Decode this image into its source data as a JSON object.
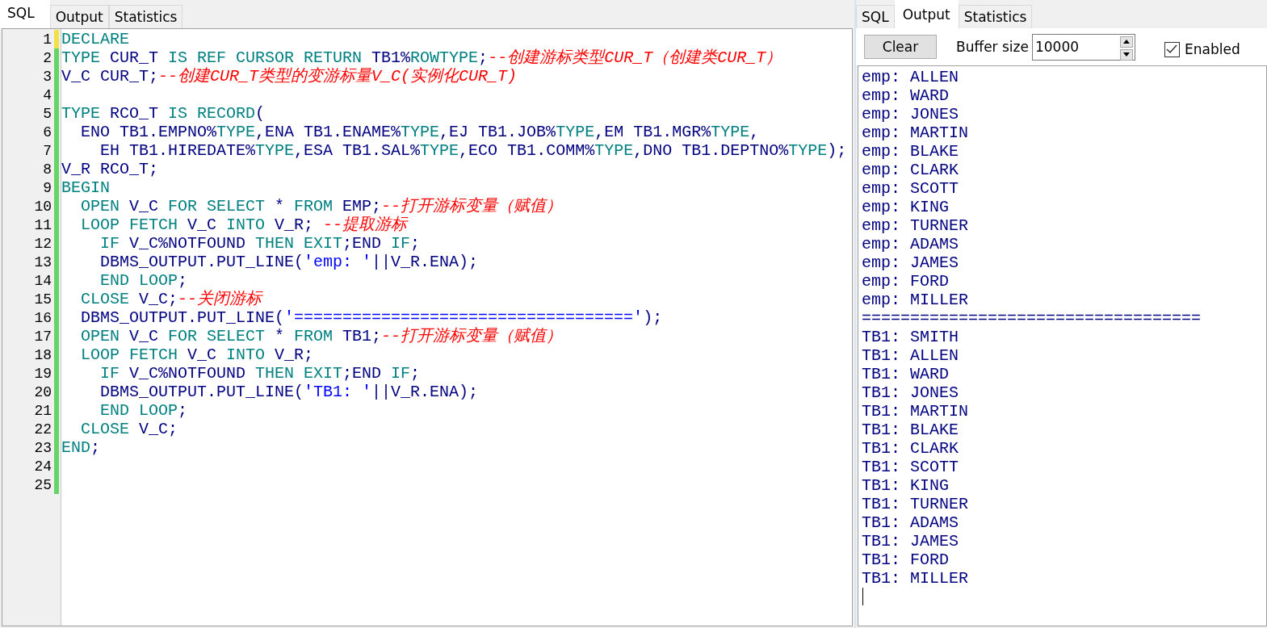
{
  "left_pane": {
    "tabs": [
      {
        "label": "SQL",
        "selected": true
      },
      {
        "label": "Output",
        "selected": false
      },
      {
        "label": "Statistics",
        "selected": false
      }
    ],
    "editor": {
      "lines": [
        {
          "number": "1",
          "color": "#f2e04a",
          "tokens": [
            {
              "kind": "keyword",
              "text": "DECLARE"
            }
          ]
        },
        {
          "number": "2",
          "color": "#66d466",
          "tokens": [
            {
              "kind": "keyword",
              "text": "TYPE "
            },
            {
              "kind": "ident",
              "text": "CUR_T "
            },
            {
              "kind": "keyword",
              "text": "IS REF CURSOR RETURN "
            },
            {
              "kind": "ident",
              "text": "TB1%"
            },
            {
              "kind": "keyword",
              "text": "ROWTYPE"
            },
            {
              "kind": "ident",
              "text": ";"
            },
            {
              "kind": "comment",
              "text": "--创建游标类型CUR_T（创建类CUR_T）"
            }
          ]
        },
        {
          "number": "3",
          "color": "#66d466",
          "tokens": [
            {
              "kind": "ident",
              "text": "V_C CUR_T;"
            },
            {
              "kind": "comment",
              "text": "--创建CUR_T类型的变游标量V_C(实例化CUR_T)"
            }
          ]
        },
        {
          "number": "4",
          "color": "#66d466"
        },
        {
          "number": "5",
          "color": "#66d466",
          "tokens": [
            {
              "kind": "keyword",
              "text": "TYPE "
            },
            {
              "kind": "ident",
              "text": "RCO_T "
            },
            {
              "kind": "keyword",
              "text": "IS RECORD"
            },
            {
              "kind": "ident",
              "text": "("
            }
          ]
        },
        {
          "number": "6",
          "color": "#66d466",
          "tokens": [
            {
              "kind": "ident",
              "text": "  ENO TB1.EMPNO%"
            },
            {
              "kind": "keyword",
              "text": "TYPE"
            },
            {
              "kind": "ident",
              "text": ",ENA TB1.ENAME%"
            },
            {
              "kind": "keyword",
              "text": "TYPE"
            },
            {
              "kind": "ident",
              "text": ",EJ TB1.JOB%"
            },
            {
              "kind": "keyword",
              "text": "TYPE"
            },
            {
              "kind": "ident",
              "text": ",EM TB1.MGR%"
            },
            {
              "kind": "keyword",
              "text": "TYPE"
            },
            {
              "kind": "ident",
              "text": ","
            }
          ]
        },
        {
          "number": "7",
          "color": "#66d466",
          "tokens": [
            {
              "kind": "ident",
              "text": "    EH TB1.HIREDATE%"
            },
            {
              "kind": "keyword",
              "text": "TYPE"
            },
            {
              "kind": "ident",
              "text": ",ESA TB1.SAL%"
            },
            {
              "kind": "keyword",
              "text": "TYPE"
            },
            {
              "kind": "ident",
              "text": ",ECO TB1.COMM%"
            },
            {
              "kind": "keyword",
              "text": "TYPE"
            },
            {
              "kind": "ident",
              "text": ",DNO TB1.DEPTNO%"
            },
            {
              "kind": "keyword",
              "text": "TYPE"
            },
            {
              "kind": "ident",
              "text": ");"
            }
          ]
        },
        {
          "number": "8",
          "color": "#66d466",
          "tokens": [
            {
              "kind": "ident",
              "text": "V_R RCO_T;"
            }
          ]
        },
        {
          "number": "9",
          "color": "#66d466",
          "tokens": [
            {
              "kind": "keyword",
              "text": "BEGIN"
            }
          ]
        },
        {
          "number": "10",
          "color": "#66d466",
          "tokens": [
            {
              "kind": "keyword",
              "text": "  OPEN "
            },
            {
              "kind": "ident",
              "text": "V_C "
            },
            {
              "kind": "keyword",
              "text": "FOR SELECT "
            },
            {
              "kind": "ident",
              "text": "* "
            },
            {
              "kind": "keyword",
              "text": "FROM "
            },
            {
              "kind": "ident",
              "text": "EMP;"
            },
            {
              "kind": "comment",
              "text": "--打开游标变量（赋值）"
            }
          ]
        },
        {
          "number": "11",
          "color": "#66d466",
          "tokens": [
            {
              "kind": "keyword",
              "text": "  LOOP FETCH "
            },
            {
              "kind": "ident",
              "text": "V_C "
            },
            {
              "kind": "keyword",
              "text": "INTO "
            },
            {
              "kind": "ident",
              "text": "V_R; "
            },
            {
              "kind": "comment",
              "text": "--提取游标"
            }
          ]
        },
        {
          "number": "12",
          "color": "#66d466",
          "tokens": [
            {
              "kind": "keyword",
              "text": "    IF "
            },
            {
              "kind": "ident",
              "text": "V_C%NOTFOUND "
            },
            {
              "kind": "keyword",
              "text": "THEN EXIT"
            },
            {
              "kind": "ident",
              "text": ";END "
            },
            {
              "kind": "keyword",
              "text": "IF"
            },
            {
              "kind": "ident",
              "text": ";"
            }
          ]
        },
        {
          "number": "13",
          "color": "#66d466",
          "tokens": [
            {
              "kind": "ident",
              "text": "    DBMS_OUTPUT.PUT_LINE("
            },
            {
              "kind": "string",
              "text": "'emp: '"
            },
            {
              "kind": "ident",
              "text": "||V_R.ENA);"
            }
          ]
        },
        {
          "number": "14",
          "color": "#66d466",
          "tokens": [
            {
              "kind": "keyword",
              "text": "    END LOOP"
            },
            {
              "kind": "ident",
              "text": ";"
            }
          ]
        },
        {
          "number": "15",
          "color": "#66d466",
          "tokens": [
            {
              "kind": "keyword",
              "text": "  CLOSE "
            },
            {
              "kind": "ident",
              "text": "V_C;"
            },
            {
              "kind": "comment",
              "text": "--关闭游标"
            }
          ]
        },
        {
          "number": "16",
          "color": "#66d466",
          "tokens": [
            {
              "kind": "ident",
              "text": "  DBMS_OUTPUT.PUT_LINE("
            },
            {
              "kind": "string",
              "text": "'==================================='"
            },
            {
              "kind": "ident",
              "text": ");"
            }
          ]
        },
        {
          "number": "17",
          "color": "#66d466",
          "tokens": [
            {
              "kind": "keyword",
              "text": "  OPEN "
            },
            {
              "kind": "ident",
              "text": "V_C "
            },
            {
              "kind": "keyword",
              "text": "FOR SELECT "
            },
            {
              "kind": "ident",
              "text": "* "
            },
            {
              "kind": "keyword",
              "text": "FROM "
            },
            {
              "kind": "ident",
              "text": "TB1;"
            },
            {
              "kind": "comment",
              "text": "--打开游标变量（赋值）"
            }
          ]
        },
        {
          "number": "18",
          "color": "#66d466",
          "tokens": [
            {
              "kind": "keyword",
              "text": "  LOOP FETCH "
            },
            {
              "kind": "ident",
              "text": "V_C "
            },
            {
              "kind": "keyword",
              "text": "INTO "
            },
            {
              "kind": "ident",
              "text": "V_R;"
            }
          ]
        },
        {
          "number": "19",
          "color": "#66d466",
          "tokens": [
            {
              "kind": "keyword",
              "text": "    IF "
            },
            {
              "kind": "ident",
              "text": "V_C%NOTFOUND "
            },
            {
              "kind": "keyword",
              "text": "THEN EXIT"
            },
            {
              "kind": "ident",
              "text": ";END "
            },
            {
              "kind": "keyword",
              "text": "IF"
            },
            {
              "kind": "ident",
              "text": ";"
            }
          ]
        },
        {
          "number": "20",
          "color": "#66d466",
          "tokens": [
            {
              "kind": "ident",
              "text": "    DBMS_OUTPUT.PUT_LINE("
            },
            {
              "kind": "string",
              "text": "'TB1: '"
            },
            {
              "kind": "ident",
              "text": "||V_R.ENA);"
            }
          ]
        },
        {
          "number": "21",
          "color": "#66d466",
          "tokens": [
            {
              "kind": "keyword",
              "text": "    END LOOP"
            },
            {
              "kind": "ident",
              "text": ";"
            }
          ]
        },
        {
          "number": "22",
          "color": "#66d466",
          "tokens": [
            {
              "kind": "keyword",
              "text": "  CLOSE "
            },
            {
              "kind": "ident",
              "text": "V_C;"
            }
          ]
        },
        {
          "number": "23",
          "color": "#66d466",
          "tokens": [
            {
              "kind": "keyword",
              "text": "END"
            },
            {
              "kind": "ident",
              "text": ";"
            }
          ]
        },
        {
          "number": "24",
          "color": "#66d466"
        },
        {
          "number": "25",
          "color": "#66d466"
        }
      ]
    }
  },
  "right_pane": {
    "tabs": [
      {
        "label": "SQL",
        "selected": false
      },
      {
        "label": "Output",
        "selected": true
      },
      {
        "label": "Statistics",
        "selected": false
      }
    ],
    "toolbar": {
      "clear_button": "Clear",
      "buffer_size": {
        "label": "Buffer size",
        "value": "10000"
      },
      "enabled": {
        "label": "Enabled",
        "checked": true
      }
    },
    "output_lines": [
      "emp: ALLEN",
      "emp: WARD",
      "emp: JONES",
      "emp: MARTIN",
      "emp: BLAKE",
      "emp: CLARK",
      "emp: SCOTT",
      "emp: KING",
      "emp: TURNER",
      "emp: ADAMS",
      "emp: JAMES",
      "emp: FORD",
      "emp: MILLER",
      "===================================",
      "TB1: SMITH",
      "TB1: ALLEN",
      "TB1: WARD",
      "TB1: JONES",
      "TB1: MARTIN",
      "TB1: BLAKE",
      "TB1: CLARK",
      "TB1: SCOTT",
      "TB1: KING",
      "TB1: TURNER",
      "TB1: ADAMS",
      "TB1: JAMES",
      "TB1: FORD",
      "TB1: MILLER"
    ]
  }
}
